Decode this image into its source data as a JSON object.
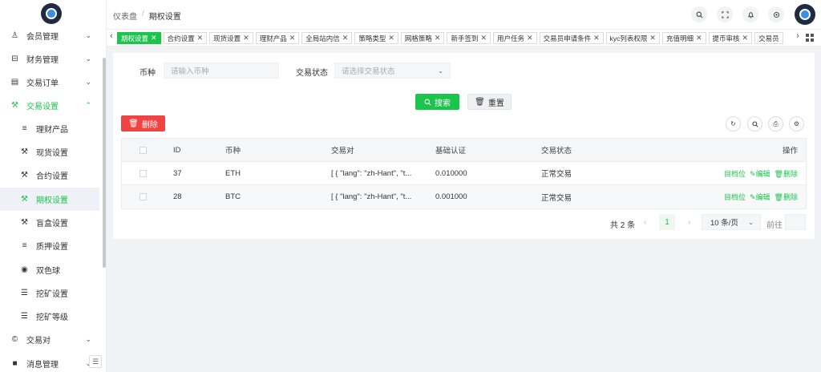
{
  "sidebar": {
    "items": [
      {
        "label": "会员管理",
        "icon": "user-icon",
        "chev": "⌄"
      },
      {
        "label": "财务管理",
        "icon": "finance-icon",
        "chev": "⌄"
      },
      {
        "label": "交易订单",
        "icon": "order-list-icon",
        "chev": "⌄"
      },
      {
        "label": "交易设置",
        "icon": "wrench-icon",
        "chev": "⌃"
      },
      {
        "label": "理财产品",
        "icon": "list-icon"
      },
      {
        "label": "现货设置",
        "icon": "wrench-icon"
      },
      {
        "label": "合约设置",
        "icon": "wrench-icon"
      },
      {
        "label": "期权设置",
        "icon": "wrench-icon"
      },
      {
        "label": "盲盒设置",
        "icon": "wrench-icon"
      },
      {
        "label": "质押设置",
        "icon": "list-icon"
      },
      {
        "label": "双色球",
        "icon": "radio-icon"
      },
      {
        "label": "挖矿设置",
        "icon": "sliders-icon"
      },
      {
        "label": "挖矿等级",
        "icon": "sliders-icon"
      },
      {
        "label": "交易对",
        "icon": "copyright-icon",
        "chev": "⌄"
      },
      {
        "label": "消息管理",
        "icon": "message-icon",
        "chev": "⌄"
      }
    ],
    "collapse_glyph": "☰"
  },
  "header": {
    "breadcrumb": [
      "仪表盘",
      "期权设置"
    ],
    "separator": "/",
    "buttons": [
      "search-icon",
      "fullscreen-icon",
      "bell-icon",
      "settings-icon"
    ]
  },
  "tabs": [
    {
      "label": "期权设置",
      "active": true
    },
    {
      "label": "合约设置"
    },
    {
      "label": "现货设置"
    },
    {
      "label": "理财产品"
    },
    {
      "label": "全局站内信"
    },
    {
      "label": "策略类型"
    },
    {
      "label": "网格策略"
    },
    {
      "label": "新手签到"
    },
    {
      "label": "用户任务"
    },
    {
      "label": "交易员申请条件"
    },
    {
      "label": "kyc列表权限"
    },
    {
      "label": "充值明细"
    },
    {
      "label": "提币审核"
    },
    {
      "label": "交易员"
    }
  ],
  "filters": {
    "coin_label": "币种",
    "coin_placeholder": "请输入币种",
    "status_label": "交易状态",
    "status_placeholder": "请选择交易状态"
  },
  "buttons": {
    "search": "搜索",
    "reset": "重置",
    "delete": "删除"
  },
  "table": {
    "columns": [
      "ID",
      "币种",
      "交易对",
      "基础认证",
      "交易状态",
      "操作"
    ],
    "rows": [
      {
        "id": "37",
        "coin": "ETH",
        "pair": "[ { \"lang\": \"zh-Hant\", \"t...",
        "base": "0.010000",
        "status": "正常交易"
      },
      {
        "id": "28",
        "coin": "BTC",
        "pair": "[ { \"lang\": \"zh-Hant\", \"t...",
        "base": "0.001000",
        "status": "正常交易"
      }
    ],
    "actions": [
      "目档位",
      "编辑",
      "删除"
    ]
  },
  "pagination": {
    "total": "共 2 条",
    "current": "1",
    "page_size": "10 条/页",
    "goto": "前往"
  },
  "colors": {
    "accent": "#1bc44b",
    "danger": "#f04444"
  }
}
